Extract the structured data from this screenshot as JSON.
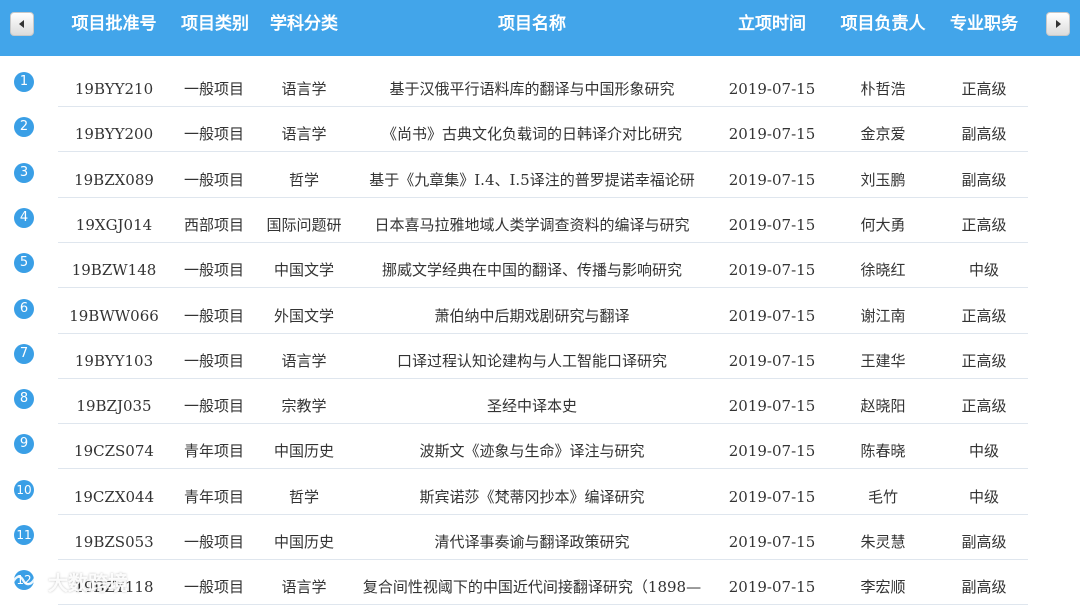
{
  "colors": {
    "header_bg": "#42a5ea",
    "number_badge": "#3a9fe6",
    "divider": "#dfe6ee"
  },
  "nav": {
    "prev_icon": "chevron-left-icon",
    "next_icon": "chevron-right-icon"
  },
  "table": {
    "headers": [
      "项目批准号",
      "项目类别",
      "学科分类",
      "项目名称",
      "立项时间",
      "项目负责人",
      "专业职务"
    ],
    "rows": [
      {
        "num": "1",
        "id": "19BYY210",
        "type": "一般项目",
        "subject": "语言学",
        "name": "基于汉俄平行语料库的翻译与中国形象研究",
        "date": "2019-07-15",
        "leader": "朴哲浩",
        "title": "正高级"
      },
      {
        "num": "2",
        "id": "19BYY200",
        "type": "一般项目",
        "subject": "语言学",
        "name": "《尚书》古典文化负载词的日韩译介对比研究",
        "date": "2019-07-15",
        "leader": "金京爱",
        "title": "副高级"
      },
      {
        "num": "3",
        "id": "19BZX089",
        "type": "一般项目",
        "subject": "哲学",
        "name": "基于《九章集》I.4、I.5译注的普罗提诺幸福论研",
        "date": "2019-07-15",
        "leader": "刘玉鹏",
        "title": "副高级"
      },
      {
        "num": "4",
        "id": "19XGJ014",
        "type": "西部项目",
        "subject": "国际问题研",
        "name": "日本喜马拉雅地域人类学调查资料的编译与研究",
        "date": "2019-07-15",
        "leader": "何大勇",
        "title": "正高级"
      },
      {
        "num": "5",
        "id": "19BZW148",
        "type": "一般项目",
        "subject": "中国文学",
        "name": "挪威文学经典在中国的翻译、传播与影响研究",
        "date": "2019-07-15",
        "leader": "徐晓红",
        "title": "中级"
      },
      {
        "num": "6",
        "id": "19BWW066",
        "type": "一般项目",
        "subject": "外国文学",
        "name": "萧伯纳中后期戏剧研究与翻译",
        "date": "2019-07-15",
        "leader": "谢江南",
        "title": "正高级"
      },
      {
        "num": "7",
        "id": "19BYY103",
        "type": "一般项目",
        "subject": "语言学",
        "name": "口译过程认知论建构与人工智能口译研究",
        "date": "2019-07-15",
        "leader": "王建华",
        "title": "正高级"
      },
      {
        "num": "8",
        "id": "19BZJ035",
        "type": "一般项目",
        "subject": "宗教学",
        "name": "圣经中译本史",
        "date": "2019-07-15",
        "leader": "赵晓阳",
        "title": "正高级"
      },
      {
        "num": "9",
        "id": "19CZS074",
        "type": "青年项目",
        "subject": "中国历史",
        "name": "波斯文《迹象与生命》译注与研究",
        "date": "2019-07-15",
        "leader": "陈春晓",
        "title": "中级"
      },
      {
        "num": "10",
        "id": "19CZX044",
        "type": "青年项目",
        "subject": "哲学",
        "name": "斯宾诺莎《梵蒂冈抄本》编译研究",
        "date": "2019-07-15",
        "leader": "毛竹",
        "title": "中级"
      },
      {
        "num": "11",
        "id": "19BZS053",
        "type": "一般项目",
        "subject": "中国历史",
        "name": "清代译事奏谕与翻译政策研究",
        "date": "2019-07-15",
        "leader": "朱灵慧",
        "title": "副高级"
      },
      {
        "num": "12",
        "id": "19BZY118",
        "type": "一般项目",
        "subject": "语言学",
        "name": "复合间性视阈下的中国近代间接翻译研究（1898—",
        "date": "2019-07-15",
        "leader": "李宏顺",
        "title": "副高级"
      }
    ]
  },
  "watermark": {
    "text": "大数跨境",
    "logo_icon": "brand-logo-icon"
  }
}
